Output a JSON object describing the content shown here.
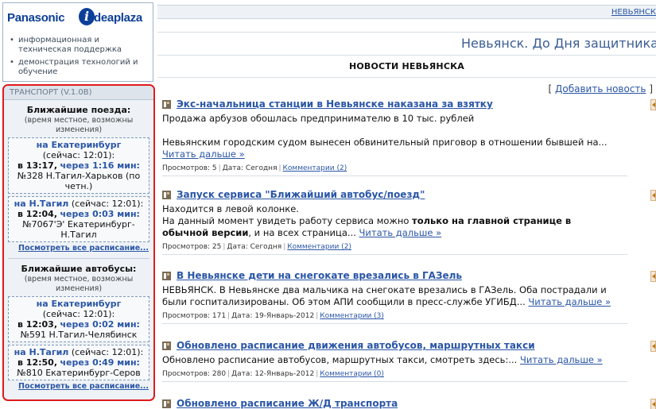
{
  "promo": {
    "logo_left": "Panasonic",
    "logo_i": "i",
    "logo_right": "deaplaza",
    "items": [
      "информационная и техническая поддержка",
      "демонстрация технологий и обучение"
    ]
  },
  "transport": {
    "header": "ТРАНСПОРТ (V.1.0B)",
    "trains_title": "Ближайшие поезда:",
    "note": "(время местное, возможны изменения)",
    "more": "Посмотреть все расписание...",
    "trains": [
      {
        "dir": "на Екатеринбург",
        "now": "(сейчас: 12:01):",
        "dt": "в 13:17,",
        "in": "через 1:16 мин:",
        "route": "№328 Н.Тагил-Харьков (по четн.)"
      },
      {
        "dir": "на Н.Тагил",
        "now": "(сейчас: 12:01):",
        "dt": "в 12:04,",
        "in": "через 0:03 мин:",
        "route": "№7067'Э' Екатеринбург-Н.Тагил"
      }
    ],
    "buses_title": "Ближайшие автобусы:",
    "buses": [
      {
        "dir": "на Екатеринбург",
        "now": "(сейчас: 12:01):",
        "dt": "в 12:03,",
        "in": "через 0:02 мин:",
        "route": "№591 Н.Тагил-Челябинск"
      },
      {
        "dir": "на Н.Тагил",
        "now": "(сейчас: 12:01):",
        "dt": "в 12:50,",
        "in": "через 0:49 мин:",
        "route": "№810 Екатеринбург-Серов"
      }
    ]
  },
  "topbar": {
    "link": "НЕВЬЯНСК"
  },
  "page_title": "Невьянск. До Дня защитника",
  "section_title": "НОВОСТИ НЕВЬЯНСКА",
  "add_news": {
    "open": "[",
    "link": "Добавить новость",
    "close": "]"
  },
  "news": [
    {
      "title": "Экс-начальница станции в Невьянске наказана за взятку",
      "lines": [
        "Продажа арбузов обошлась предпринимателю в 10 тыс. рублей",
        "",
        "Невьянским городским судом вынесен обвинительный приговор в отношении бывшей на..."
      ],
      "read_more": "Читать дальше »",
      "views_label": "Просмотров:",
      "views": "5",
      "date_label": "Дата:",
      "date": "Сегодня",
      "comments": "Комментарии (2)"
    },
    {
      "title": "Запуск сервиса \"Ближайший автобус/поезд\"",
      "line1": "Находится в левой колонке.",
      "line2_pre": "На данный момент увидеть работу сервиса можно ",
      "line2_bold": "только на главной странице в обычной версии",
      "line2_post": ", и на всех страница...",
      "read_more": "Читать дальше »",
      "views_label": "Просмотров:",
      "views": "25",
      "date_label": "Дата:",
      "date": "Сегодня",
      "comments": "Комментарии (2)"
    },
    {
      "title": "В Невьянске дети на снегокате врезались в ГАЗель",
      "text": "НЕВЬЯНСК. В Невьянске два мальчика на снегокате врезались в ГАЗель. Оба пострадали и были госпитализированы. Об этом АПИ сообщили в пресс-службе УГИБД...",
      "read_more": "Читать дальше »",
      "views_label": "Просмотров:",
      "views": "171",
      "date_label": "Дата:",
      "date": "19-Январь-2012",
      "comments": "Комментарии (3)"
    },
    {
      "title": "Обновлено расписание движения автобусов, маршрутных такси",
      "text": "Обновлено расписание автобусов, маршрутных такси, смотреть здесь:...",
      "read_more": "Читать дальше »",
      "views_label": "Просмотров:",
      "views": "280",
      "date_label": "Дата:",
      "date": "12-Январь-2012",
      "comments": "Комментарии (0)"
    },
    {
      "title": "Обновлено расписание Ж/Д транспорта"
    }
  ]
}
